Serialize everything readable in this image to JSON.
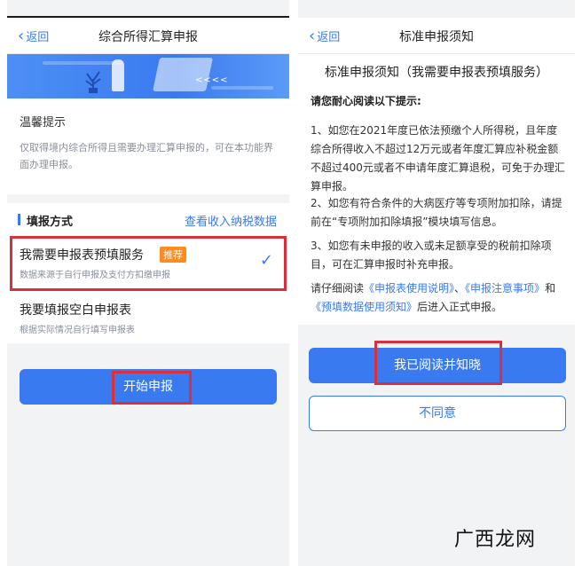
{
  "left": {
    "back_label": "返回",
    "title": "综合所得汇算申报",
    "notice_title": "温馨提示",
    "notice_body": "仅取得境内综合所得且需要办理汇算申报的，可在本功能界面办理申报。",
    "method_label": "填报方式",
    "view_income_link": "查看收入纳税数据",
    "option1": {
      "title": "我需要申报表预填服务",
      "badge": "推荐",
      "desc": "数据来源于自行申报及支付方扣缴申报"
    },
    "option2": {
      "title": "我要填报空白申报表",
      "desc": "根据实际情况自行填写申报表"
    },
    "start_button": "开始申报"
  },
  "right": {
    "back_label": "返回",
    "title": "标准申报须知",
    "heading": "标准申报须知（我需要申报表预填服务）",
    "intro": "请您耐心阅读以下提示:",
    "para1": "1、如您在2021年度已依法预缴个人所得税，且年度综合所得收入不超过12万元或者年度汇算应补税金额不超过400元或者不申请年度汇算退税，可免于办理汇算申报。",
    "para2": "2、如您有符合条件的大病医疗等专项附加扣除，请提前在“专项附加扣除填报”模块填写信息。",
    "para3": "3、如您有未申报的收入或未足额享受的税前扣除项目，可在汇算申报时补充申报。",
    "para4_prefix": "请仔细阅读",
    "link1": "《申报表使用说明》",
    "para4_sep1": "、",
    "link2": "《申报注意事项》",
    "para4_sep2": "和",
    "link3": "《预填数据使用须知》",
    "para4_suffix": "后进入正式申报。",
    "agree_button": "我已阅读并知晓",
    "disagree_button": "不同意"
  },
  "watermark": "广西龙网",
  "colors": {
    "accent": "#3a7af0",
    "badge": "#ff8a1f",
    "highlight_box": "#d9303d"
  },
  "icons": {
    "back": "chevron-left-icon",
    "selected": "checkmark-icon"
  }
}
